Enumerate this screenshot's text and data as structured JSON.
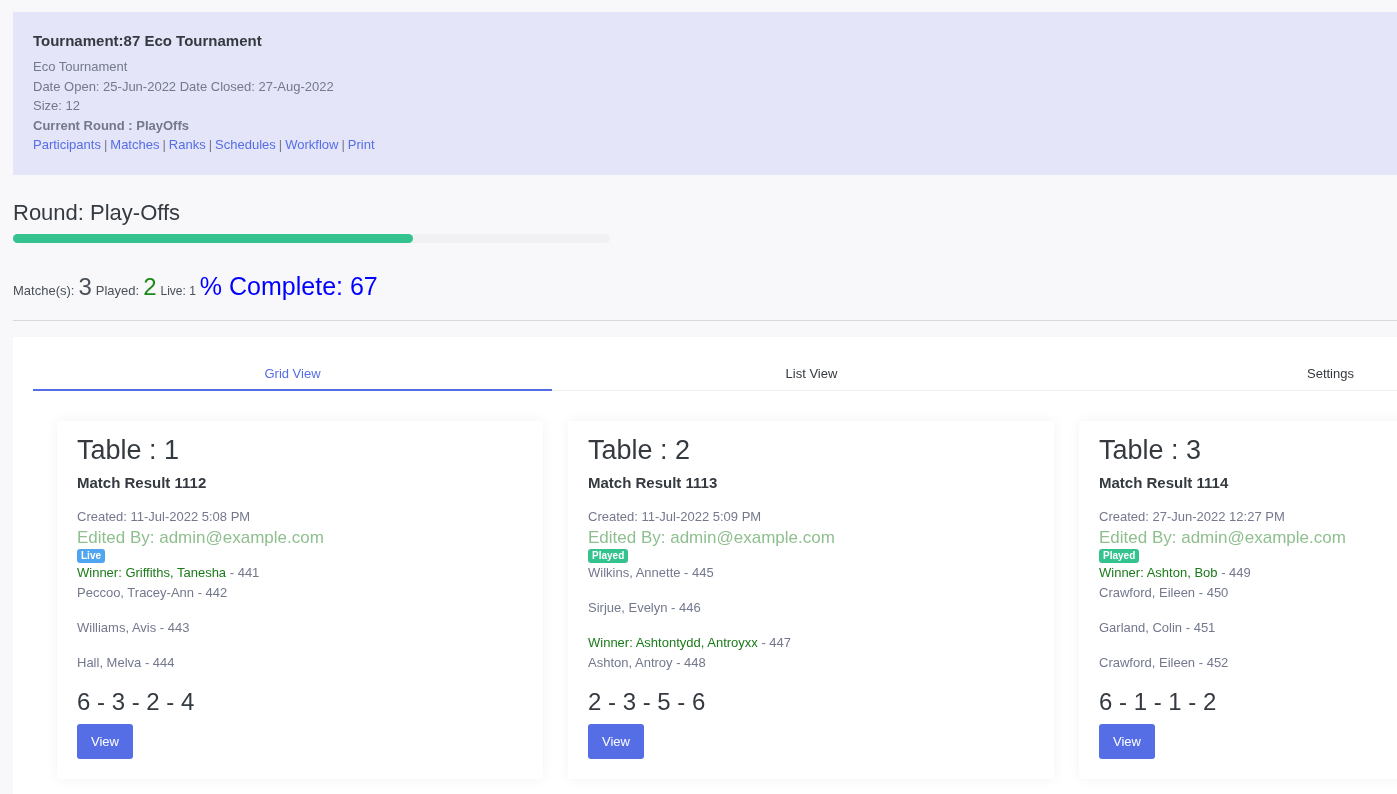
{
  "tournament": {
    "title": "Tournament:87 Eco Tournament",
    "name": "Eco Tournament",
    "dates": "Date Open: 25-Jun-2022 Date Closed: 27-Aug-2022",
    "size": "Size: 12",
    "current_round": "Current Round : PlayOffs",
    "links": [
      {
        "kind": "link",
        "text": "Participants"
      },
      {
        "kind": "separator",
        "text": "|"
      },
      {
        "kind": "link",
        "text": "Matches"
      },
      {
        "kind": "separator",
        "text": "|"
      },
      {
        "kind": "link",
        "text": "Ranks"
      },
      {
        "kind": "separator",
        "text": "|"
      },
      {
        "kind": "link",
        "text": "Schedules"
      },
      {
        "kind": "separator",
        "text": "|"
      },
      {
        "kind": "link",
        "text": "Workflow"
      },
      {
        "kind": "separator",
        "text": "|"
      },
      {
        "kind": "link",
        "text": "Print"
      }
    ]
  },
  "round": {
    "title": "Round: Play-Offs",
    "level": 0.67
  },
  "stats": {
    "matches_label": "Matche(s):",
    "matches": "3",
    "played_label": "Played:",
    "played": "2",
    "live": "Live: 1",
    "complete": "% Complete: 67"
  },
  "tabs": [
    {
      "label": "Grid View",
      "selected": true
    },
    {
      "label": "List View",
      "selected": false
    },
    {
      "label": "Settings",
      "selected": false
    }
  ],
  "cards": [
    {
      "table": "Table : 1",
      "match": "Match Result 1112",
      "created": "Created: 11-Jul-2022 5:08 PM",
      "edited": "Edited By: admin@example.com",
      "status": {
        "kind": "live",
        "label": "Live"
      },
      "groups": [
        [
          {
            "prefix": "Winner:",
            "name": "Griffiths, Tanesha",
            "number": "- 441",
            "winner": true
          },
          {
            "name": "Peccoo, Tracey-Ann",
            "number": "- 442",
            "winner": false
          }
        ],
        [
          {
            "name": "Williams, Avis",
            "number": "- 443",
            "winner": false
          }
        ],
        [
          {
            "name": "Hall, Melva",
            "number": "- 444",
            "winner": false
          }
        ]
      ],
      "score": "6 - 3 - 2 - 4",
      "button": "View"
    },
    {
      "table": "Table : 2",
      "match": "Match Result 1113",
      "created": "Created: 11-Jul-2022 5:09 PM",
      "edited": "Edited By: admin@example.com",
      "status": {
        "kind": "played",
        "label": "Played"
      },
      "groups": [
        [
          {
            "name": "Wilkins, Annette",
            "number": "- 445",
            "winner": false
          }
        ],
        [
          {
            "name": "Sirjue, Evelyn",
            "number": "- 446",
            "winner": false
          }
        ],
        [
          {
            "prefix": "Winner:",
            "name": "Ashtontydd, Antroyxx",
            "number": "- 447",
            "winner": true
          },
          {
            "name": "Ashton, Antroy",
            "number": "- 448",
            "winner": false
          }
        ]
      ],
      "score": "2 - 3 - 5 - 6",
      "button": "View"
    },
    {
      "table": "Table : 3",
      "match": "Match Result 1114",
      "created": "Created: 27-Jun-2022 12:27 PM",
      "edited": "Edited By: admin@example.com",
      "status": {
        "kind": "played",
        "label": "Played"
      },
      "groups": [
        [
          {
            "prefix": "Winner:",
            "name": "Ashton, Bob",
            "number": "- 449",
            "winner": true
          },
          {
            "name": "Crawford, Eileen",
            "number": "- 450",
            "winner": false
          }
        ],
        [
          {
            "name": "Garland, Colin",
            "number": "- 451",
            "winner": false
          }
        ],
        [
          {
            "name": "Crawford, Eileen",
            "number": "- 452",
            "winner": false
          }
        ]
      ],
      "score": "6 - 1 - 1 - 2",
      "button": "View"
    }
  ]
}
